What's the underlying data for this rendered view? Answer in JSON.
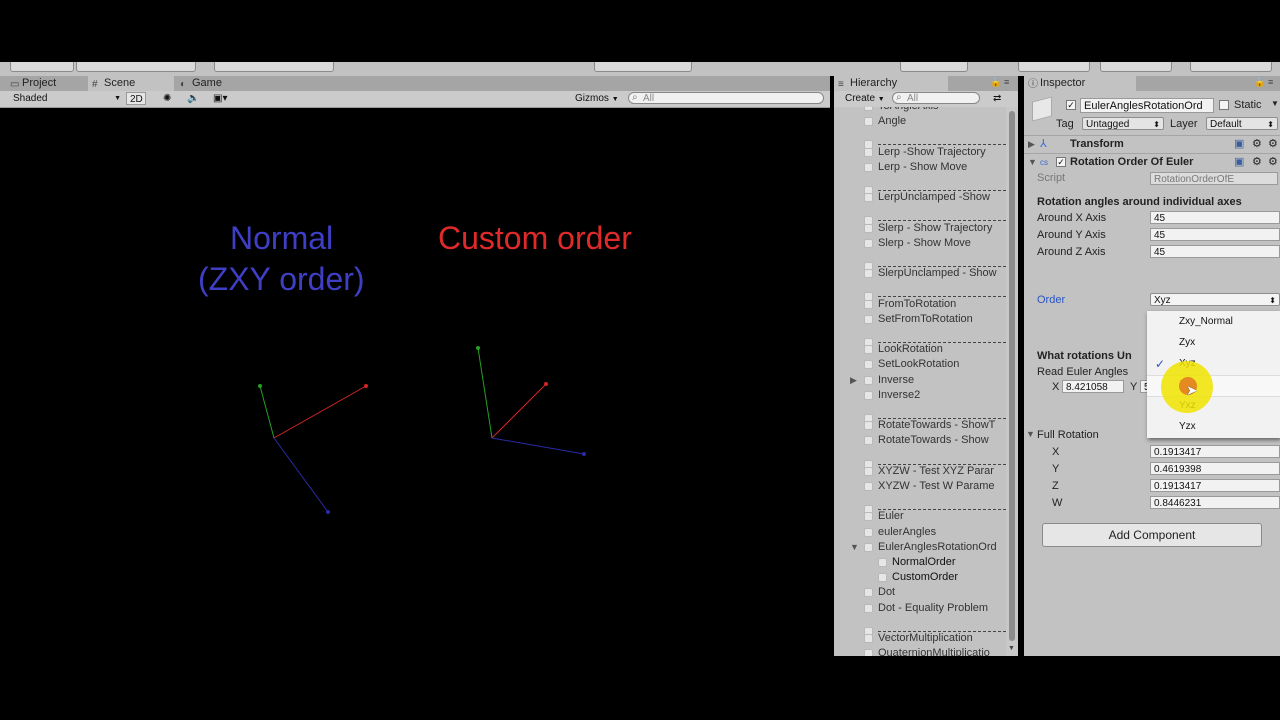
{
  "scene_panel": {
    "tabs": [
      {
        "label": "Project",
        "icon": "folder-icon"
      },
      {
        "label": "Scene",
        "icon": "grid-icon"
      },
      {
        "label": "Game",
        "icon": "game-icon"
      }
    ],
    "shading_mode": "Shaded",
    "mode_2d": "2D",
    "gizmos": "Gizmos",
    "search_placeholder": "All",
    "label_normal_line1": "Normal",
    "label_normal_line2": "(ZXY order)",
    "label_custom": "Custom order",
    "colors": {
      "normal_label": "#3f3fc6",
      "custom_label": "#e02a2a",
      "axis_x": "#d62424",
      "axis_y": "#23a023",
      "axis_z": "#2a2aa8"
    }
  },
  "hierarchy": {
    "tab": "Hierarchy",
    "create_label": "Create",
    "search_placeholder": "All",
    "items": [
      {
        "label": "ToAngleAxis",
        "type": "item"
      },
      {
        "label": "Angle",
        "type": "item"
      },
      {
        "type": "separator"
      },
      {
        "label": "Lerp -Show Trajectory",
        "type": "item"
      },
      {
        "label": "Lerp - Show Move",
        "type": "item"
      },
      {
        "type": "separator"
      },
      {
        "label": "LerpUnclamped -Show",
        "type": "item"
      },
      {
        "type": "separator"
      },
      {
        "label": "Slerp - Show Trajectory",
        "type": "item"
      },
      {
        "label": "Slerp - Show Move",
        "type": "item"
      },
      {
        "type": "separator"
      },
      {
        "label": "SlerpUnclamped - Show",
        "type": "item"
      },
      {
        "type": "separator"
      },
      {
        "label": "FromToRotation",
        "type": "item"
      },
      {
        "label": "SetFromToRotation",
        "type": "item"
      },
      {
        "type": "separator"
      },
      {
        "label": "LookRotation",
        "type": "item"
      },
      {
        "label": "SetLookRotation",
        "type": "item"
      },
      {
        "label": "Inverse",
        "type": "item",
        "arrow": "collapsed"
      },
      {
        "label": "Inverse2",
        "type": "item"
      },
      {
        "type": "separator"
      },
      {
        "label": "RotateTowards - ShowT",
        "type": "item"
      },
      {
        "label": "RotateTowards - Show",
        "type": "item"
      },
      {
        "type": "separator"
      },
      {
        "label": "XYZW - Test XYZ Parar",
        "type": "item"
      },
      {
        "label": "XYZW - Test W Parame",
        "type": "item"
      },
      {
        "type": "separator"
      },
      {
        "label": "Euler",
        "type": "item"
      },
      {
        "label": "eulerAngles",
        "type": "item"
      },
      {
        "label": "EulerAnglesRotationOrd",
        "type": "item",
        "arrow": "expanded"
      },
      {
        "label": "NormalOrder",
        "type": "child"
      },
      {
        "label": "CustomOrder",
        "type": "child"
      },
      {
        "label": "Dot",
        "type": "item"
      },
      {
        "label": "Dot - Equality Problem",
        "type": "item"
      },
      {
        "type": "separator"
      },
      {
        "label": "VectorMultiplication",
        "type": "item"
      },
      {
        "label": "QuaternionMultiplicatio",
        "type": "item"
      }
    ]
  },
  "inspector": {
    "tab": "Inspector",
    "object_name": "EulerAnglesRotationOrd",
    "static_label": "Static",
    "tag_label": "Tag",
    "tag_value": "Untagged",
    "layer_label": "Layer",
    "layer_value": "Default",
    "transform_label": "Transform",
    "component_label": "Rotation Order Of Euler",
    "script_label": "Script",
    "script_value": "RotationOrderOfE",
    "section_angles": "Rotation angles around individual axes",
    "around_x_label": "Around X Axis",
    "around_x_value": "45",
    "around_y_label": "Around Y Axis",
    "around_y_value": "45",
    "around_z_label": "Around Z Axis",
    "around_z_value": "45",
    "order_label": "Order",
    "order_value": "Xyz",
    "section_what": "What rotations Un",
    "read_euler_label": "Read Euler Angles",
    "euler_x_label": "X",
    "euler_x_value": "8.421058",
    "euler_y_label": "Y",
    "euler_y_value": "5",
    "full_rotation_label": "Full Rotation",
    "full": [
      {
        "label": "X",
        "value": "0.1913417"
      },
      {
        "label": "Y",
        "value": "0.4619398"
      },
      {
        "label": "Z",
        "value": "0.1913417"
      },
      {
        "label": "W",
        "value": "0.8446231"
      }
    ],
    "add_component": "Add Component",
    "dropdown_options": [
      "Zxy_Normal",
      "Zyx",
      "Xyz",
      "Xzy",
      "Yxz",
      "Yzx"
    ],
    "dropdown_selected": "Xyz"
  }
}
